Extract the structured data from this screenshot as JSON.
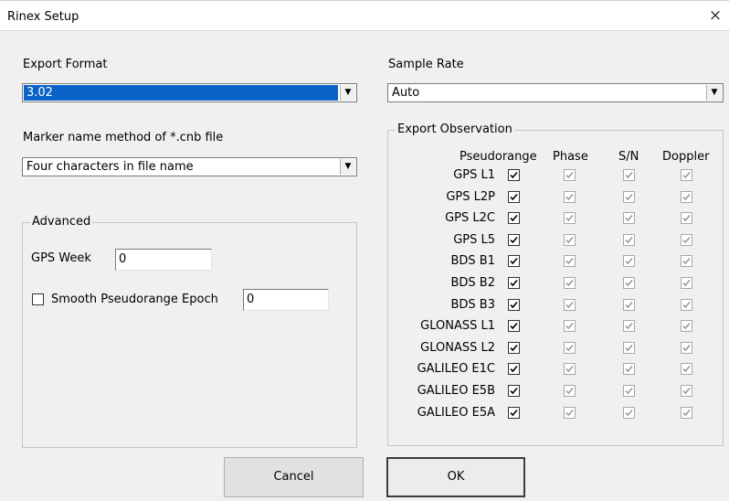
{
  "window": {
    "title": "Rinex Setup",
    "close_glyph": "×",
    "close_icon": "close-icon"
  },
  "export_format": {
    "label": "Export Format",
    "value": "3.02"
  },
  "sample_rate": {
    "label": "Sample Rate",
    "value": "Auto"
  },
  "marker_name": {
    "label": "Marker name method of *.cnb file",
    "value": "Four characters in file name"
  },
  "advanced": {
    "legend": "Advanced",
    "gps_week_label": "GPS Week",
    "gps_week_value": "0",
    "smooth_label": "Smooth Pseudorange Epoch",
    "smooth_checked": false,
    "smooth_value": "0"
  },
  "observation": {
    "legend": "Export Observation",
    "columns": [
      "Pseudorange",
      "Phase",
      "S/N",
      "Doppler"
    ],
    "rows": [
      {
        "label": "GPS L1",
        "pseudorange": true,
        "phase": true,
        "sn": true,
        "doppler": true
      },
      {
        "label": "GPS L2P",
        "pseudorange": true,
        "phase": true,
        "sn": true,
        "doppler": true
      },
      {
        "label": "GPS L2C",
        "pseudorange": true,
        "phase": true,
        "sn": true,
        "doppler": true
      },
      {
        "label": "GPS L5",
        "pseudorange": true,
        "phase": true,
        "sn": true,
        "doppler": true
      },
      {
        "label": "BDS B1",
        "pseudorange": true,
        "phase": true,
        "sn": true,
        "doppler": true
      },
      {
        "label": "BDS B2",
        "pseudorange": true,
        "phase": true,
        "sn": true,
        "doppler": true
      },
      {
        "label": "BDS B3",
        "pseudorange": true,
        "phase": true,
        "sn": true,
        "doppler": true
      },
      {
        "label": "GLONASS L1",
        "pseudorange": true,
        "phase": true,
        "sn": true,
        "doppler": true
      },
      {
        "label": "GLONASS L2",
        "pseudorange": true,
        "phase": true,
        "sn": true,
        "doppler": true
      },
      {
        "label": "GALILEO E1C",
        "pseudorange": true,
        "phase": true,
        "sn": true,
        "doppler": true
      },
      {
        "label": "GALILEO E5B",
        "pseudorange": true,
        "phase": true,
        "sn": true,
        "doppler": true
      },
      {
        "label": "GALILEO E5A",
        "pseudorange": true,
        "phase": true,
        "sn": true,
        "doppler": true
      }
    ]
  },
  "buttons": {
    "cancel": "Cancel",
    "ok": "OK"
  },
  "colors": {
    "selection": "#0a64c8",
    "dialog_bg": "#f0f0f0"
  }
}
